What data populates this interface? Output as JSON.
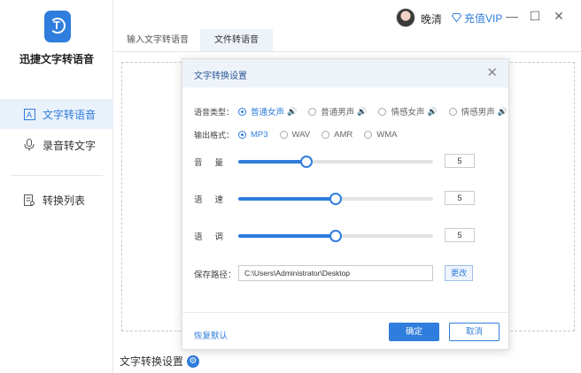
{
  "app": {
    "title": "迅捷文字转语音"
  },
  "sidebar": {
    "items": [
      {
        "label": "文字转语音",
        "icon": "text-icon",
        "active": true
      },
      {
        "label": "录音转文字",
        "icon": "microphone-icon",
        "active": false
      },
      {
        "label": "转换列表",
        "icon": "list-icon",
        "active": false
      }
    ]
  },
  "topbar": {
    "username": "晚清",
    "vip_label": "充值VIP"
  },
  "tabs": [
    {
      "label": "输入文字转语音",
      "active": false
    },
    {
      "label": "文件转语音",
      "active": true
    }
  ],
  "bottom": {
    "settings_label": "文字转换设置"
  },
  "dialog": {
    "title": "文字转换设置",
    "voice_type": {
      "label": "语音类型：",
      "options": [
        "普通女声",
        "普通男声",
        "情感女声",
        "情感男声"
      ],
      "selected": "普通女声"
    },
    "output_format": {
      "label": "输出格式：",
      "options": [
        "MP3",
        "WAV",
        "AMR",
        "WMA"
      ],
      "selected": "MP3"
    },
    "sliders": [
      {
        "label": "音量",
        "value": "5",
        "level": 0.35
      },
      {
        "label": "语速",
        "value": "5",
        "level": 0.5
      },
      {
        "label": "语调",
        "value": "5",
        "level": 0.5
      }
    ],
    "save_path": {
      "label": "保存路径：",
      "value": "C:\\Users\\Administrator\\Desktop",
      "change_label": "更改"
    },
    "restore_label": "恢复默认",
    "ok_label": "确定",
    "cancel_label": "取消"
  },
  "colors": {
    "accent": "#2f7ddc"
  }
}
